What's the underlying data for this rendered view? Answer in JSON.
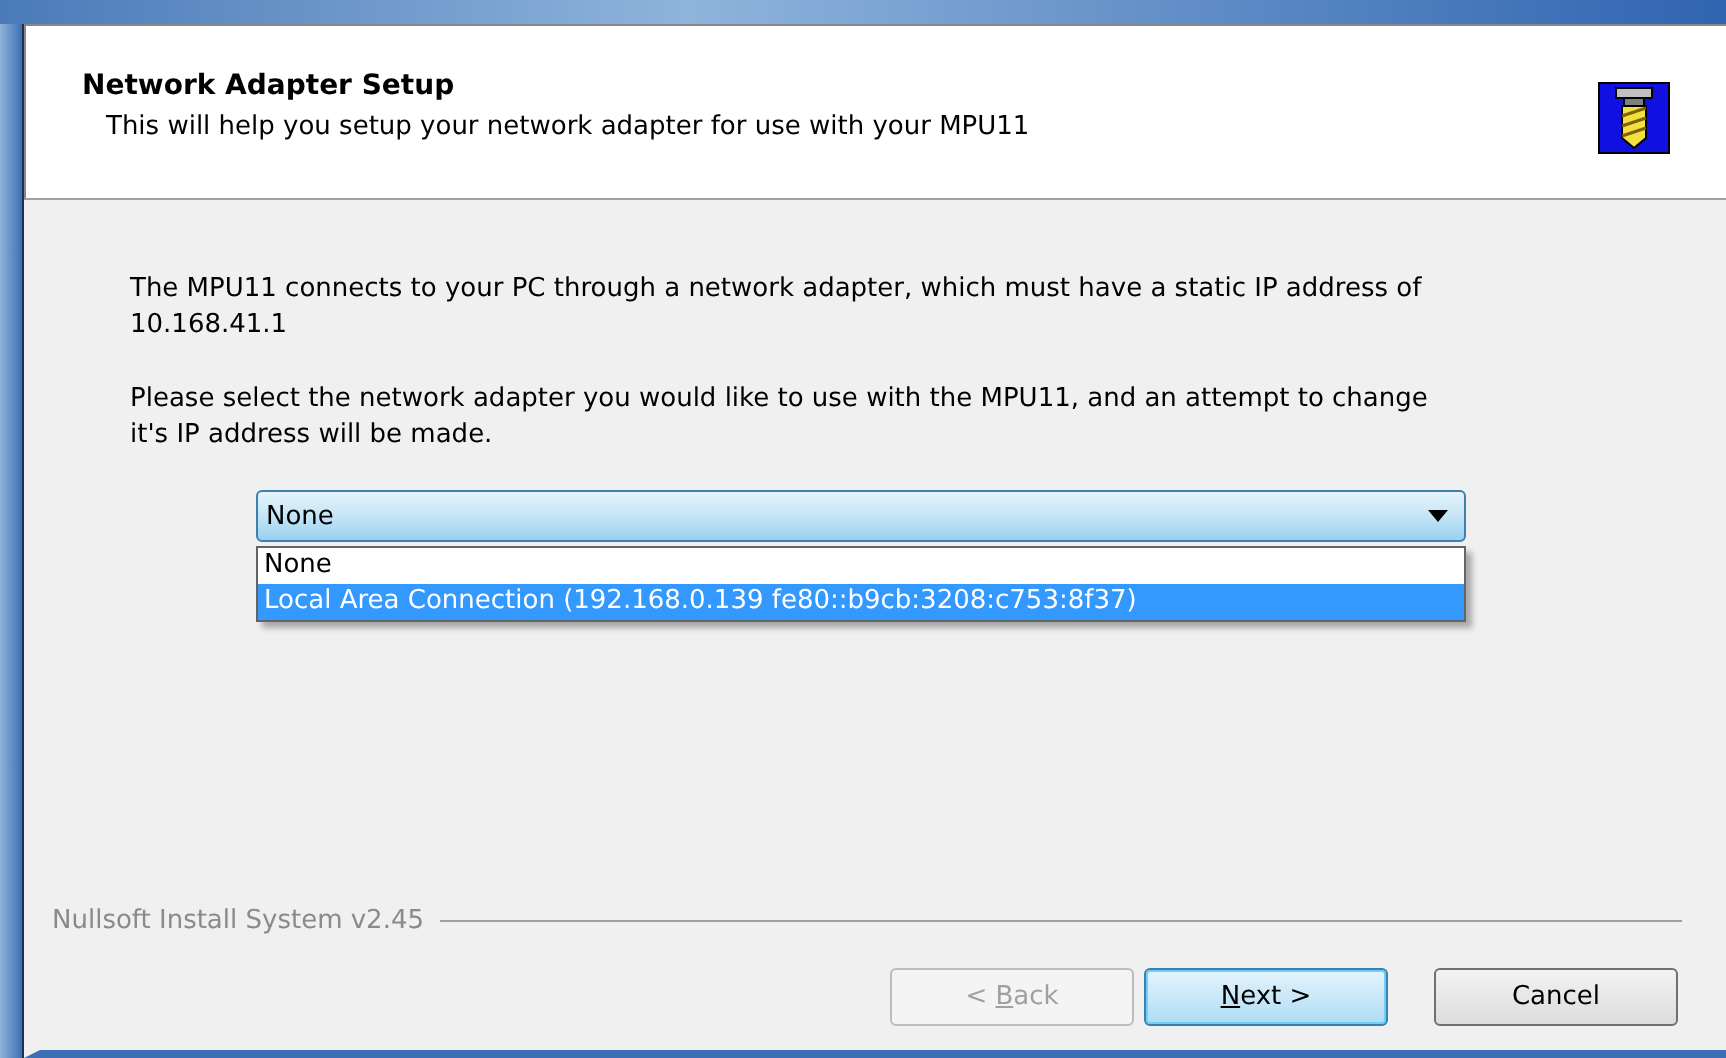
{
  "header": {
    "title": "Network Adapter Setup",
    "subtitle": "This will help you setup your network adapter for use with your MPU11"
  },
  "body": {
    "paragraphs": [
      "The MPU11 connects to your PC through a network adapter, which must have a static IP address of 10.168.41.1",
      "Please select the network adapter you would like to use with the MPU11, and an attempt to change it's IP address will be made."
    ],
    "dropdown": {
      "value": "None",
      "expanded": true,
      "options": [
        {
          "label": "None",
          "highlighted": false
        },
        {
          "label": "Local Area Connection (192.168.0.139 fe80::b9cb:3208:c753:8f37)",
          "highlighted": true
        }
      ]
    }
  },
  "branding": "Nullsoft Install System v2.45",
  "buttons": [
    {
      "before": "< ",
      "key": "B",
      "after": "ack",
      "disabled": true,
      "default": false
    },
    {
      "key": "N",
      "after": "ext >",
      "disabled": false,
      "default": true
    },
    {
      "before": "Cancel",
      "disabled": false,
      "default": false
    }
  ]
}
